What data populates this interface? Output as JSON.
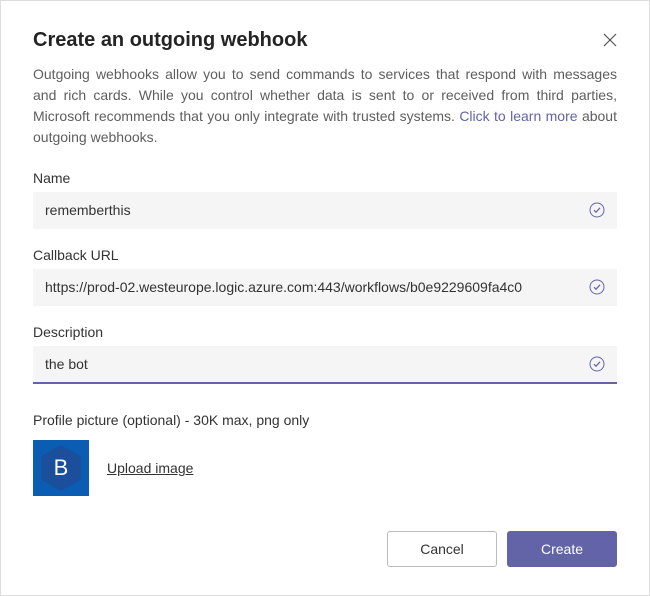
{
  "dialog": {
    "title": "Create an outgoing webhook",
    "intro_pre": "Outgoing webhooks allow you to send commands to services that respond with messages and rich cards. While you control whether data is sent to or received from third parties, Microsoft recommends that you only integrate with trusted systems. ",
    "intro_link": "Click to learn more",
    "intro_post": " about outgoing webhooks."
  },
  "fields": {
    "name": {
      "label": "Name",
      "value": "rememberthis"
    },
    "callback": {
      "label": "Callback URL",
      "value": "https://prod-02.westeurope.logic.azure.com:443/workflows/b0e9229609fa4c0"
    },
    "description": {
      "label": "Description",
      "value": "the bot"
    }
  },
  "profile": {
    "label": "Profile picture (optional) - 30K max, png only",
    "avatar_letter": "B",
    "upload_label": "Upload image",
    "avatar_bg": "#0f6cbd",
    "avatar_inner": "#174ea6"
  },
  "actions": {
    "cancel": "Cancel",
    "create": "Create"
  }
}
